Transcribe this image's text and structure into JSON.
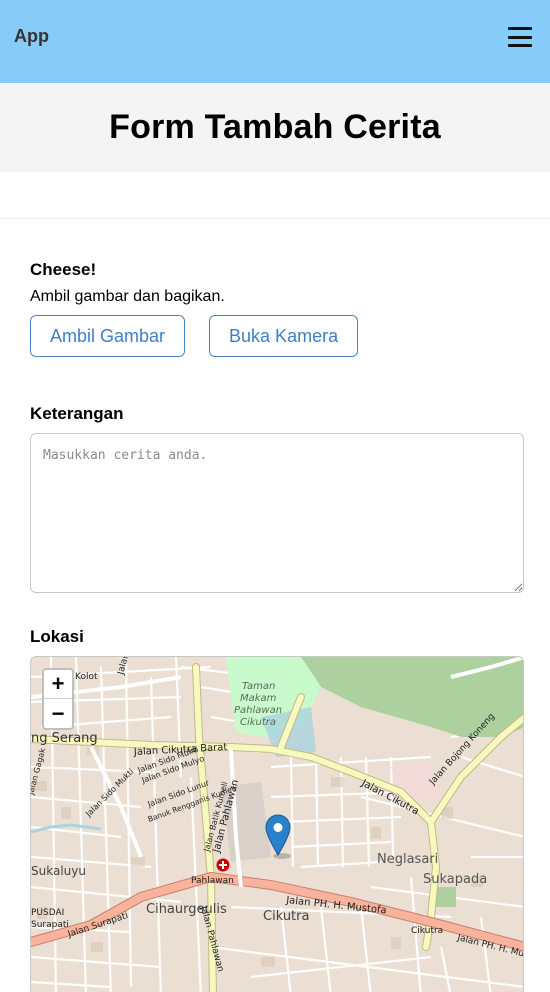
{
  "app": {
    "brand": "App",
    "menu_icon": "hamburger-icon"
  },
  "page": {
    "title": "Form Tambah Cerita"
  },
  "photo": {
    "label": "Cheese!",
    "description": "Ambil gambar dan bagikan.",
    "pick_button": "Ambil Gambar",
    "camera_button": "Buka Kamera"
  },
  "keterangan": {
    "label": "Keterangan",
    "placeholder": "Masukkan cerita anda.",
    "value": ""
  },
  "lokasi": {
    "label": "Lokasi",
    "zoom_in": "+",
    "zoom_out": "−",
    "marker_icon": "map-marker-icon",
    "place_labels": {
      "kolot": "Kolot",
      "cigadung": "Jalan Cigad",
      "taman_makam_1": "Taman",
      "taman_makam_2": "Makam",
      "taman_makam_3": "Pahlawan",
      "taman_makam_4": "Cikutra",
      "jalan_bojong_koneng": "Jalan Bojong Koneng",
      "ng_serang": "ng Serang",
      "jalan_cikutra_barat": "Jalan Cikutra Barat",
      "jalan_sido_mukti_1": "Jalan Sido Mukti",
      "jalan_sido_mulyo": "Jalan Sido Mulyo",
      "jalan_sido_lunur": "Jalan Sido Lunur",
      "jalan_sido_mukti_2": "Jalan Sido Mukti",
      "banuk_rengganis": "Banuk Rengganis Kumeli",
      "jalan_batik": "Jalan Batik Kumeli",
      "jalan_pahlawan": "Jalan Pahlawan",
      "jalan_cikutra": "Jalan Cikutra",
      "sukaluyu": "Sukaluyu",
      "neglasari": "Neglasari",
      "sukapada": "Sukapada",
      "pahlawan": "Pahlawan",
      "cihaurgeulis": "Cihaurgeulis",
      "cikutra": "Cikutra",
      "jalan_ph_mustofa": "Jalan PH. H. Mustofa",
      "cikutra_2": "Cikutra",
      "pusdai": "PUSDAI",
      "surapati": "Surapati",
      "jalan_surapati": "Jalan Surapati",
      "jalan_pahlawan_2": "Jalan Pahlawan",
      "jalan_ph_mu": "Jalan PH. H. Mu",
      "jalan_gagak": "Jalan Gagak"
    }
  },
  "colors": {
    "app_bar": "#87cbf8",
    "accent": "#3f7fc6",
    "primary_road": "#f9b29c",
    "secondary_road": "#f7fabf",
    "park": "#c8facc",
    "forest": "#add19e"
  }
}
